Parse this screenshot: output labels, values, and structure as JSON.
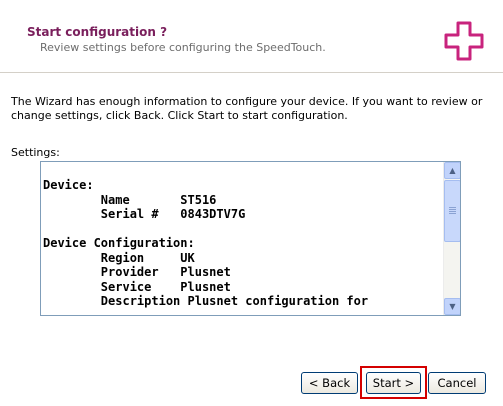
{
  "header": {
    "title": "Start configuration ?",
    "subtitle": "Review settings before configuring the SpeedTouch."
  },
  "intro": "The Wizard has enough information to configure your device. If you want to review or change settings, click Back. Click Start to start configuration.",
  "settings": {
    "label": "Settings:",
    "content": "Device:\n        Name       ST516\n        Serial #   0843DTV7G\n\nDevice Configuration:\n        Region     UK\n        Provider   Plusnet\n        Service    Plusnet\n        Description Plusnet configuration for"
  },
  "buttons": {
    "back": "< Back",
    "start": "Start >",
    "cancel": "Cancel"
  },
  "colors": {
    "title": "#7a1f5c",
    "logo": "#c8237d",
    "highlight": "#d40000"
  }
}
